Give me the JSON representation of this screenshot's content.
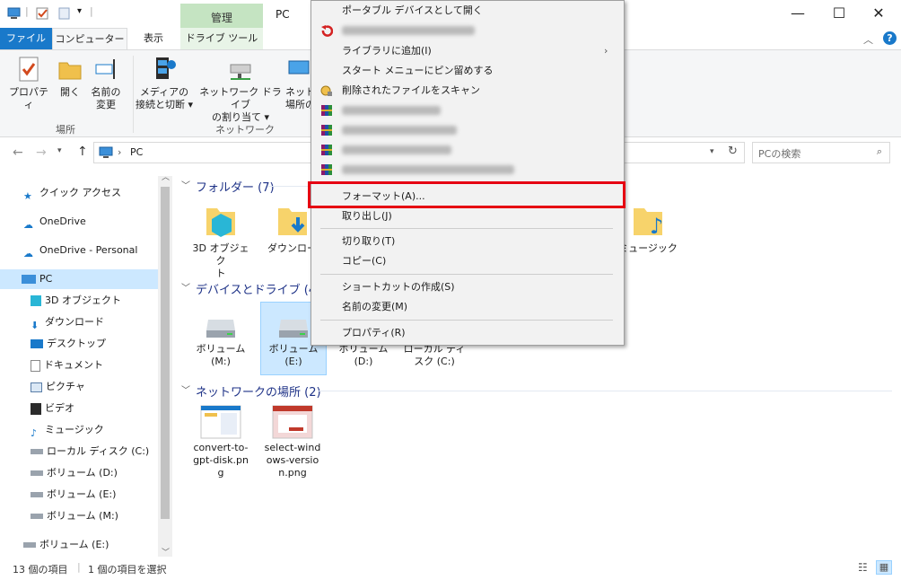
{
  "window": {
    "title": "PC",
    "manage_tab": "管理",
    "controls": {
      "minimize": "—",
      "maximize": "☐",
      "close": "✕"
    }
  },
  "ribbon_tabs": {
    "file": "ファイル",
    "computer": "コンピューター",
    "view": "表示",
    "drive_tools": "ドライブ ツール"
  },
  "ribbon": {
    "properties": "プロパティ",
    "open": "開く",
    "rename_line1": "名前の",
    "rename_line2": "変更",
    "group_location": "場所",
    "media_line1": "メディアの",
    "media_line2": "接続と切断 ▾",
    "netdrive_line1": "ネットワーク ドライブ",
    "netdrive_line2": "の割り当て ▾",
    "netloc_line1": "ネットワーク",
    "netloc_line2": "場所の",
    "group_network": "ネットワーク"
  },
  "address": {
    "path": "PC",
    "search_placeholder": "PCの検索"
  },
  "nav": {
    "quick_access": "クイック アクセス",
    "onedrive": "OneDrive",
    "onedrive_personal": "OneDrive - Personal",
    "pc": "PC",
    "items": [
      "3D オブジェクト",
      "ダウンロード",
      "デスクトップ",
      "ドキュメント",
      "ピクチャ",
      "ビデオ",
      "ミュージック",
      "ローカル ディスク (C:)",
      "ボリューム (D:)",
      "ボリューム (E:)",
      "ボリューム (M:)"
    ],
    "volume_e": "ボリューム (E:)"
  },
  "content": {
    "folders_header": "フォルダー (7)",
    "folder_3d_line1": "3D オブジェク",
    "folder_3d_line2": "ト",
    "folder_download": "ダウンロー",
    "folder_music": "ミュージック",
    "devices_header": "デバイスとドライブ (4)",
    "drives": [
      {
        "line1": "ボリューム",
        "line2": "(M:)"
      },
      {
        "line1": "ボリューム",
        "line2": "(E:)"
      },
      {
        "line1": "ボリューム",
        "line2": "(D:)"
      },
      {
        "line1": "ローカル ディ",
        "line2": "スク (C:)"
      }
    ],
    "network_header": "ネットワークの場所 (2)",
    "network_items": [
      {
        "line1": "convert-to-",
        "line2": "gpt-disk.pn",
        "line3": "g"
      },
      {
        "line1": "select-wind",
        "line2": "ows-versio",
        "line3": "n.png"
      }
    ]
  },
  "status": {
    "count": "13 個の項目",
    "selected": "1 個の項目を選択"
  },
  "context_menu": {
    "open_portable": "ポータブル デバイスとして開く",
    "add_to_library": "ライブラリに追加(I)",
    "pin_start": "スタート メニューにピン留めする",
    "scan_deleted": "削除されたファイルをスキャン",
    "format": "フォーマット(A)...",
    "eject": "取り出し(J)",
    "cut": "切り取り(T)",
    "copy": "コピー(C)",
    "create_shortcut": "ショートカットの作成(S)",
    "rename": "名前の変更(M)",
    "properties": "プロパティ(R)"
  },
  "colors": {
    "accent": "#1979ca",
    "highlight": "#e60012",
    "manage_tab": "#c5e4c2",
    "group_header": "#1e3287"
  }
}
